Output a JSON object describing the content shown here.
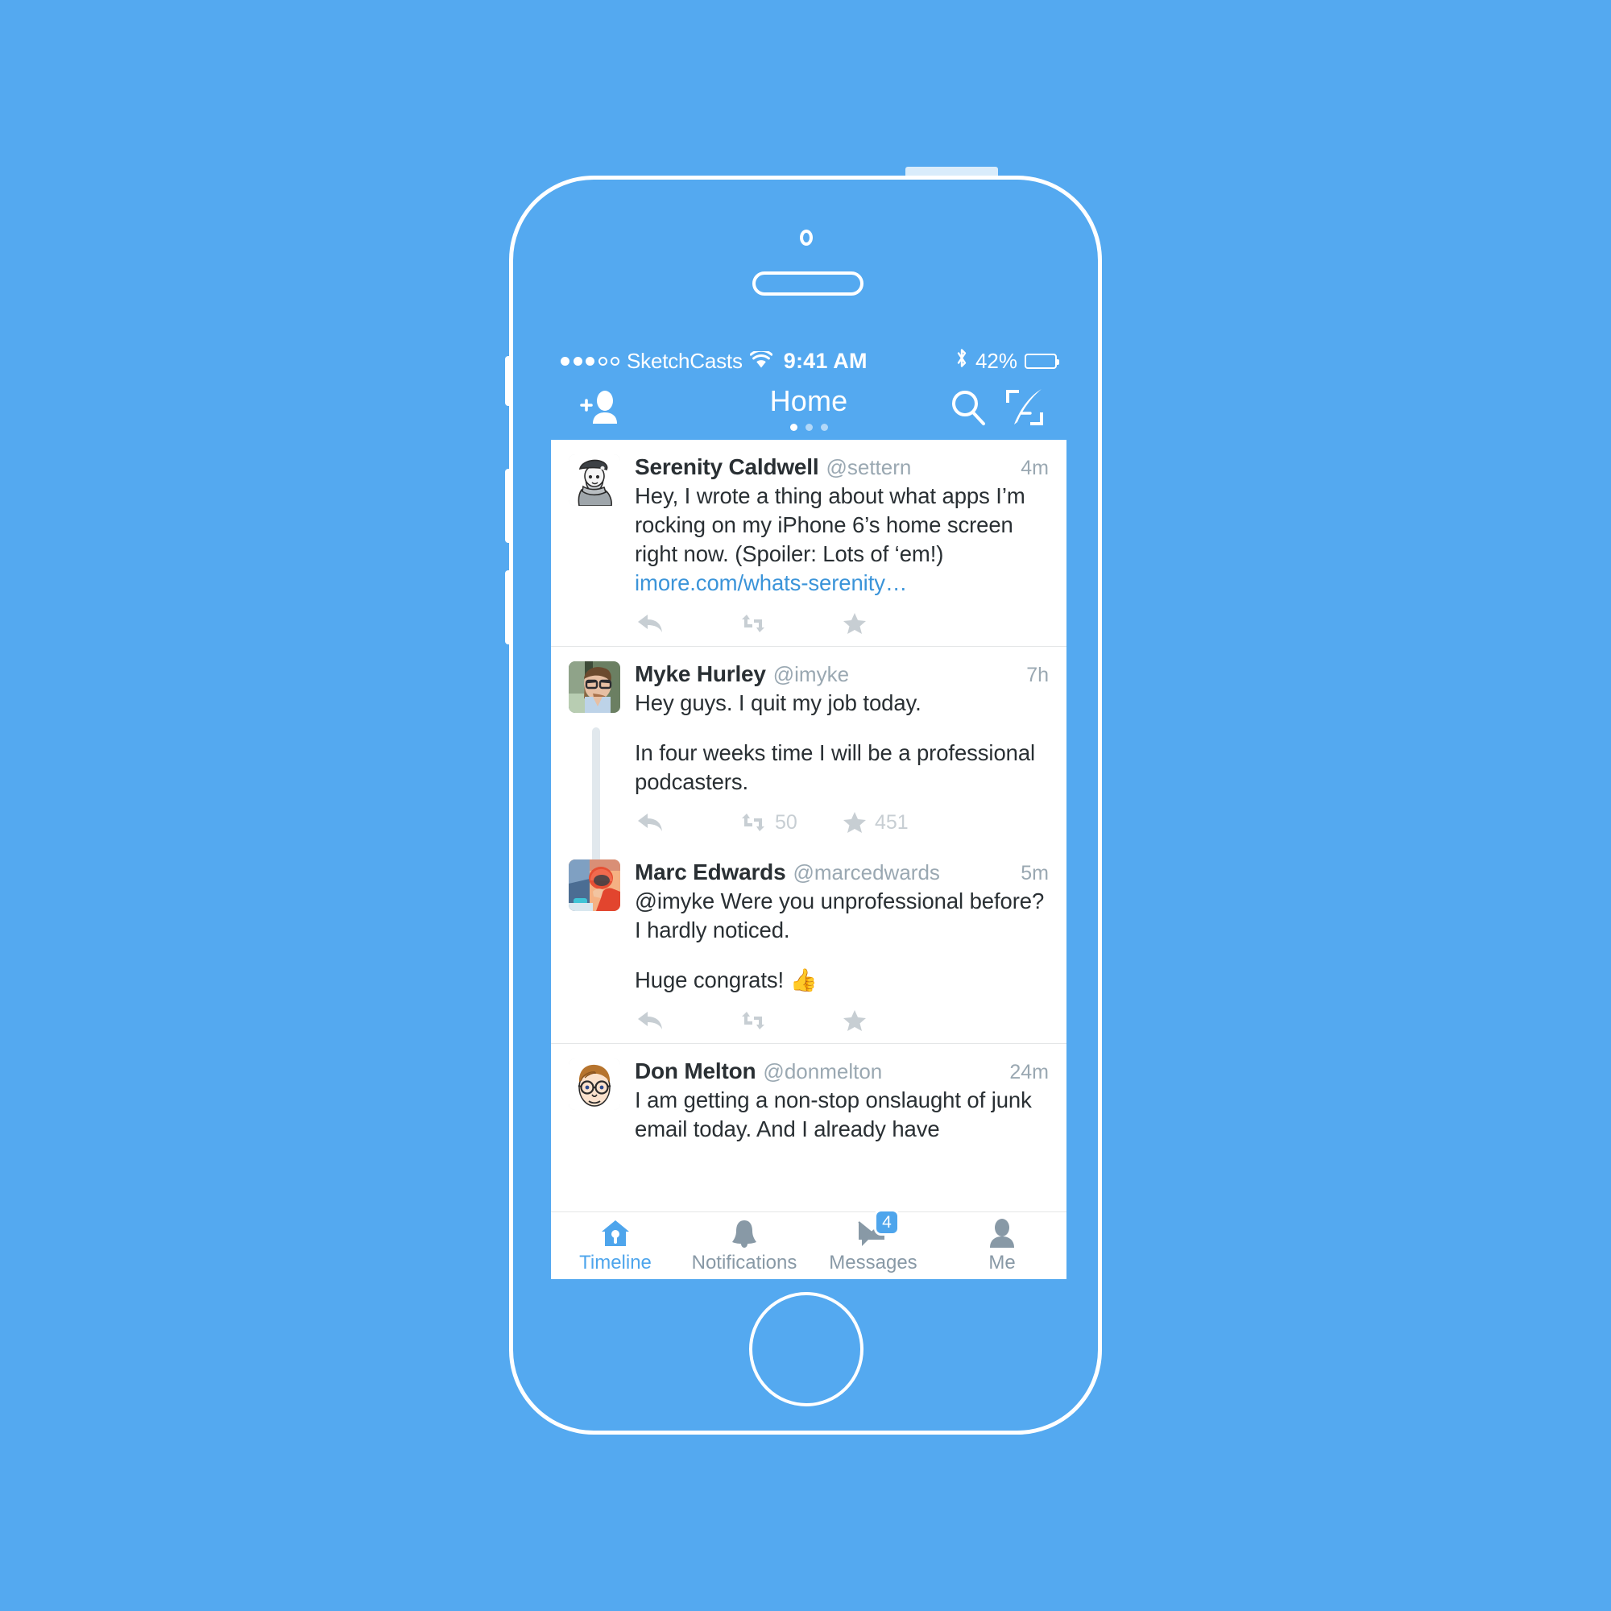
{
  "device": {
    "frame_color": "#ffffff",
    "background_color": "#54a9f0",
    "power_button": "power-button",
    "home_button": "home-button"
  },
  "status_bar": {
    "signal_dots_filled": 3,
    "signal_dots_total": 5,
    "carrier": "SketchCasts",
    "wifi_icon": "wifi-icon",
    "time": "9:41 AM",
    "bluetooth_icon": "bluetooth-icon",
    "battery_percent": "42%",
    "battery_level": 42
  },
  "nav_bar": {
    "title": "Home",
    "add_person_icon": "add-person-icon",
    "search_icon": "search-icon",
    "compose_icon": "compose-icon",
    "page_dots": 3,
    "active_dot_index": 0
  },
  "theme": {
    "accent": "#4ea5ec",
    "link": "#3b94d9",
    "text": "#292f33",
    "muted": "#9aa8b2",
    "action_icon": "#c7ced3",
    "separator": "#e4e6e7",
    "thread_line": "#e1e8ed"
  },
  "timeline": {
    "tweets": [
      {
        "id": "tweet-serenity",
        "author": "Serenity Caldwell",
        "handle": "@settern",
        "time": "4m",
        "avatar": "avatar-serenity",
        "text_before_link": "Hey, I wrote a thing about what apps I’m rocking on my iPhone 6’s home screen right now. (Spoiler: Lots of ‘em!) ",
        "link": "imore.com/whats-serenity…",
        "actions": {
          "reply": "",
          "retweet": "",
          "favorite": ""
        },
        "thread": false
      },
      {
        "id": "tweet-myke",
        "author": "Myke Hurley",
        "handle": "@imyke",
        "time": "7h",
        "avatar": "avatar-myke",
        "paragraphs": [
          "Hey guys. I quit my job today.",
          "In four weeks time I will be a professional podcasters."
        ],
        "actions": {
          "reply": "",
          "retweet": "50",
          "favorite": "451"
        },
        "thread": true
      },
      {
        "id": "tweet-marc",
        "author": "Marc Edwards",
        "handle": "@marcedwards",
        "time": "5m",
        "avatar": "avatar-marc",
        "paragraphs": [
          "@imyke Were you unprofessional before? I hardly noticed.",
          "Huge congrats! 👍"
        ],
        "actions": {
          "reply": "",
          "retweet": "",
          "favorite": ""
        },
        "thread": false
      },
      {
        "id": "tweet-don",
        "author": "Don Melton",
        "handle": "@donmelton",
        "time": "24m",
        "avatar": "avatar-don",
        "paragraphs": [
          "I am getting a non-stop onslaught of junk email today. And I already have"
        ],
        "actions": {
          "reply": "",
          "retweet": "",
          "favorite": ""
        },
        "thread": false
      }
    ]
  },
  "tab_bar": {
    "tabs": [
      {
        "label": "Timeline",
        "icon": "birdhouse-icon",
        "active": true,
        "badge": ""
      },
      {
        "label": "Notifications",
        "icon": "bell-icon",
        "active": false,
        "badge": ""
      },
      {
        "label": "Messages",
        "icon": "envelope-icon",
        "active": false,
        "badge": "4"
      },
      {
        "label": "Me",
        "icon": "person-icon",
        "active": false,
        "badge": ""
      }
    ]
  }
}
